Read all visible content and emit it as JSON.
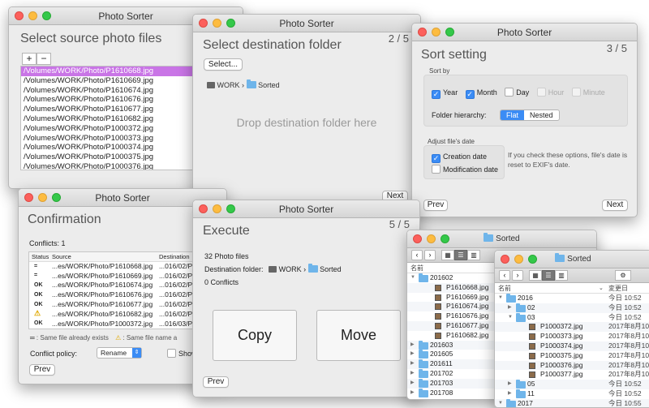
{
  "colors": {
    "accent": "#3b8cf5",
    "folder": "#6fb5ea",
    "selection": "#c975e6"
  },
  "source": {
    "title": "Photo Sorter",
    "heading": "Select source photo files",
    "add": "+",
    "remove": "−",
    "files": [
      "/Volumes/WORK/Photo/P1610668.jpg",
      "/Volumes/WORK/Photo/P1610669.jpg",
      "/Volumes/WORK/Photo/P1610674.jpg",
      "/Volumes/WORK/Photo/P1610676.jpg",
      "/Volumes/WORK/Photo/P1610677.jpg",
      "/Volumes/WORK/Photo/P1610682.jpg",
      "/Volumes/WORK/Photo/P1000372.jpg",
      "/Volumes/WORK/Photo/P1000373.jpg",
      "/Volumes/WORK/Photo/P1000374.jpg",
      "/Volumes/WORK/Photo/P1000375.jpg",
      "/Volumes/WORK/Photo/P1000376.jpg"
    ]
  },
  "dest": {
    "title": "Photo Sorter",
    "heading": "Select destination folder",
    "step": "2 / 5",
    "select_btn": "Select...",
    "path_disk": "WORK",
    "path_sep": "›",
    "path_folder": "Sorted",
    "drop": "Drop destination folder here",
    "next": "Next"
  },
  "sort": {
    "title": "Photo Sorter",
    "heading": "Sort setting",
    "step": "3 / 5",
    "sort_by": "Sort by",
    "year": "Year",
    "month": "Month",
    "day": "Day",
    "hour": "Hour",
    "minute": "Minute",
    "hierarchy_label": "Folder hierarchy:",
    "flat": "Flat",
    "nested": "Nested",
    "adjust": "Adjust file's date",
    "creation": "Creation date",
    "modification": "Modification date",
    "note": "If you check these options, file's date is reset to EXIF's date.",
    "prev": "Prev",
    "next": "Next"
  },
  "confirm": {
    "title": "Photo Sorter",
    "heading": "Confirmation",
    "conflicts": "Conflicts: 1",
    "cols": [
      "Status",
      "Source",
      "Destination"
    ],
    "rows": [
      {
        "status": "=",
        "src": "...es/WORK/Photo/P1610668.jpg",
        "dst": "...016/02/P"
      },
      {
        "status": "=",
        "src": "...es/WORK/Photo/P1610669.jpg",
        "dst": "...016/02/P"
      },
      {
        "status": "OK",
        "src": "...es/WORK/Photo/P1610674.jpg",
        "dst": "...016/02/P"
      },
      {
        "status": "OK",
        "src": "...es/WORK/Photo/P1610676.jpg",
        "dst": "...016/02/P"
      },
      {
        "status": "OK",
        "src": "...es/WORK/Photo/P1610677.jpg",
        "dst": "...016/02/P"
      },
      {
        "status": "⚠",
        "src": "...es/WORK/Photo/P1610682.jpg",
        "dst": "...016/02/P"
      },
      {
        "status": "OK",
        "src": "...es/WORK/Photo/P1000372.jpg",
        "dst": "...016/03/P"
      }
    ],
    "legend_same": ": Same file already exists",
    "legend_name": ": Same file name a",
    "policy_label": "Conflict policy:",
    "policy": "Rename",
    "show": "Show",
    "prev": "Prev"
  },
  "execute": {
    "title": "Photo Sorter",
    "heading": "Execute",
    "step": "5 / 5",
    "photo_files": "32 Photo files",
    "dest_label": "Destination folder:",
    "path_disk": "WORK",
    "path_sep": "›",
    "path_folder": "Sorted",
    "conflicts": "0 Conflicts",
    "copy": "Copy",
    "move": "Move",
    "prev": "Prev"
  },
  "finder_back": {
    "title": "Sorted",
    "col_name": "名前",
    "items": [
      {
        "name": "201602",
        "kind": "folder",
        "open": true
      },
      {
        "name": "P1610668.jpg",
        "kind": "file"
      },
      {
        "name": "P1610669.jpg",
        "kind": "file"
      },
      {
        "name": "P1610674.jpg",
        "kind": "file"
      },
      {
        "name": "P1610676.jpg",
        "kind": "file"
      },
      {
        "name": "P1610677.jpg",
        "kind": "file"
      },
      {
        "name": "P1610682.jpg",
        "kind": "file"
      },
      {
        "name": "201603",
        "kind": "folder"
      },
      {
        "name": "201605",
        "kind": "folder"
      },
      {
        "name": "201611",
        "kind": "folder"
      },
      {
        "name": "201702",
        "kind": "folder"
      },
      {
        "name": "201703",
        "kind": "folder"
      },
      {
        "name": "201708",
        "kind": "folder"
      }
    ]
  },
  "finder_front": {
    "title": "Sorted",
    "col_name": "名前",
    "col_date": "変更日",
    "items": [
      {
        "name": "2016",
        "kind": "folder",
        "open": true,
        "date": "今日 10:52"
      },
      {
        "name": "02",
        "kind": "folder",
        "date": "今日 10:52"
      },
      {
        "name": "03",
        "kind": "folder",
        "open": true,
        "date": "今日 10:52"
      },
      {
        "name": "P1000372.jpg",
        "kind": "file",
        "date": "2017年8月10"
      },
      {
        "name": "P1000373.jpg",
        "kind": "file",
        "date": "2017年8月10"
      },
      {
        "name": "P1000374.jpg",
        "kind": "file",
        "date": "2017年8月10"
      },
      {
        "name": "P1000375.jpg",
        "kind": "file",
        "date": "2017年8月10"
      },
      {
        "name": "P1000376.jpg",
        "kind": "file",
        "date": "2017年8月10"
      },
      {
        "name": "P1000377.jpg",
        "kind": "file",
        "date": "2017年8月10"
      },
      {
        "name": "05",
        "kind": "folder",
        "date": "今日 10:52"
      },
      {
        "name": "11",
        "kind": "folder",
        "date": "今日 10:52"
      },
      {
        "name": "2017",
        "kind": "folder",
        "open": true,
        "date": "今日 10:55"
      }
    ]
  }
}
